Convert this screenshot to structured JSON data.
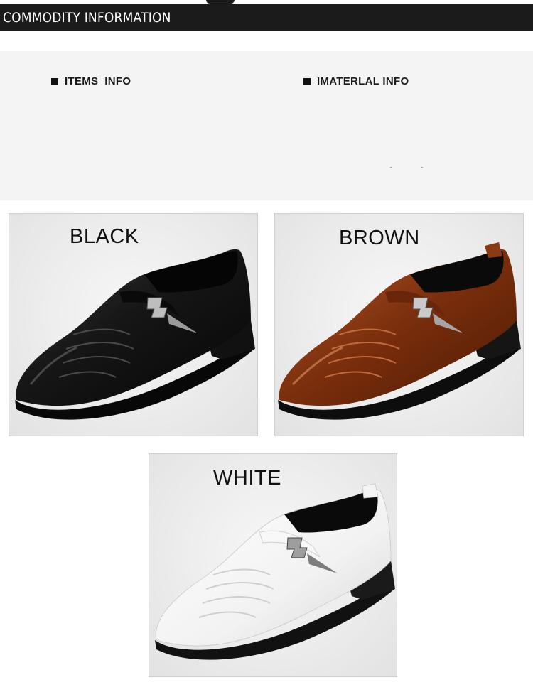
{
  "header": {
    "title": "COMMODITY INFORMATION"
  },
  "info": {
    "items_label": "ITEMS  INFO",
    "material_label": "IMATERLAL INFO"
  },
  "colors_options": [
    {
      "label": "BLACK",
      "color": "#141414"
    },
    {
      "label": "BROWN",
      "color": "#7a2e0c"
    },
    {
      "label": "WHITE",
      "color": "#f6f6f6"
    }
  ]
}
